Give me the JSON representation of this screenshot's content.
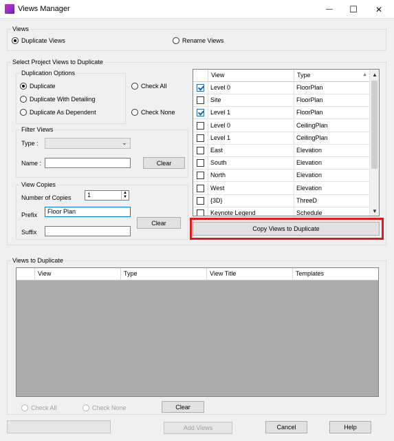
{
  "window": {
    "title": "Views Manager",
    "minimize_glyph": "—",
    "maximize_glyph": "☐",
    "close_glyph": "✕"
  },
  "views_group": {
    "legend": "Views",
    "duplicate_views": "Duplicate Views",
    "rename_views": "Rename Views",
    "selected": "Duplicate Views"
  },
  "select_group": {
    "legend": "Select Project Views to Duplicate",
    "duplication_options": {
      "legend": "Duplication Options",
      "duplicate": "Duplicate",
      "with_detailing": "Duplicate With Detailing",
      "as_dependent": "Duplicate As Dependent",
      "selected": "Duplicate"
    },
    "check_all": "Check All",
    "check_none": "Check None",
    "filter_views": {
      "legend": "Filter Views",
      "type_label": "Type :",
      "type_value": "",
      "name_label": "Name :",
      "name_value": "",
      "clear": "Clear"
    },
    "view_copies": {
      "legend": "View Copies",
      "number_label": "Number of Copies",
      "number_value": "1",
      "prefix_label": "Prefix",
      "prefix_value": "Floor Plan",
      "suffix_label": "Suffix",
      "suffix_value": "",
      "clear": "Clear"
    }
  },
  "views_grid": {
    "columns": [
      "View",
      "Type"
    ],
    "rows": [
      {
        "checked": true,
        "view": "Level 0",
        "type": "FloorPlan"
      },
      {
        "checked": false,
        "view": "Site",
        "type": "FloorPlan"
      },
      {
        "checked": true,
        "view": "Level 1",
        "type": "FloorPlan"
      },
      {
        "checked": false,
        "view": "Level 0",
        "type": "CeilingPlan"
      },
      {
        "checked": false,
        "view": "Level 1",
        "type": "CeilingPlan"
      },
      {
        "checked": false,
        "view": "East",
        "type": "Elevation"
      },
      {
        "checked": false,
        "view": "South",
        "type": "Elevation"
      },
      {
        "checked": false,
        "view": "North",
        "type": "Elevation"
      },
      {
        "checked": false,
        "view": "West",
        "type": "Elevation"
      },
      {
        "checked": false,
        "view": "{3D}",
        "type": "ThreeD"
      },
      {
        "checked": false,
        "view": "Keynote Legend",
        "type": "Schedule"
      }
    ]
  },
  "copy_button": "Copy Views to Duplicate",
  "dup_group": {
    "legend": "Views to Duplicate",
    "columns": [
      "View",
      "Type",
      "View Title",
      "Templates"
    ],
    "check_all": "Check All",
    "check_none": "Check None",
    "clear": "Clear"
  },
  "footer": {
    "add_views": "Add Views",
    "cancel": "Cancel",
    "help": "Help"
  }
}
